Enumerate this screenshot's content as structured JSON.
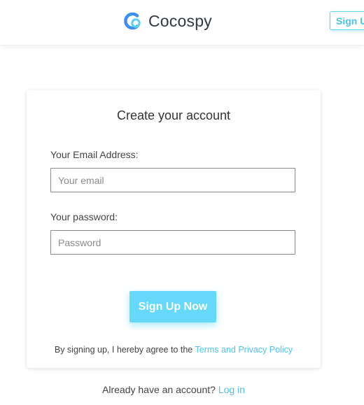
{
  "header": {
    "brand_name": "Cocospy",
    "signup_label": "Sign Up"
  },
  "form": {
    "title": "Create your account",
    "email_label": "Your Email Address:",
    "email_placeholder": "Your email",
    "email_value": "",
    "password_label": "Your password:",
    "password_placeholder": "Password",
    "password_value": "",
    "submit_label": "Sign Up Now",
    "terms_prefix": "By signing up, I hereby agree to the ",
    "terms_link": "Terms and Privacy Policy"
  },
  "footer": {
    "login_prompt": "Already have an account? ",
    "login_link": "Log in"
  },
  "colors": {
    "accent": "#66d9fb",
    "link": "#4cc3ea",
    "logo_blue": "#3a8ff0"
  },
  "icons": {
    "brand_logo": "cocospy-logo-icon"
  }
}
